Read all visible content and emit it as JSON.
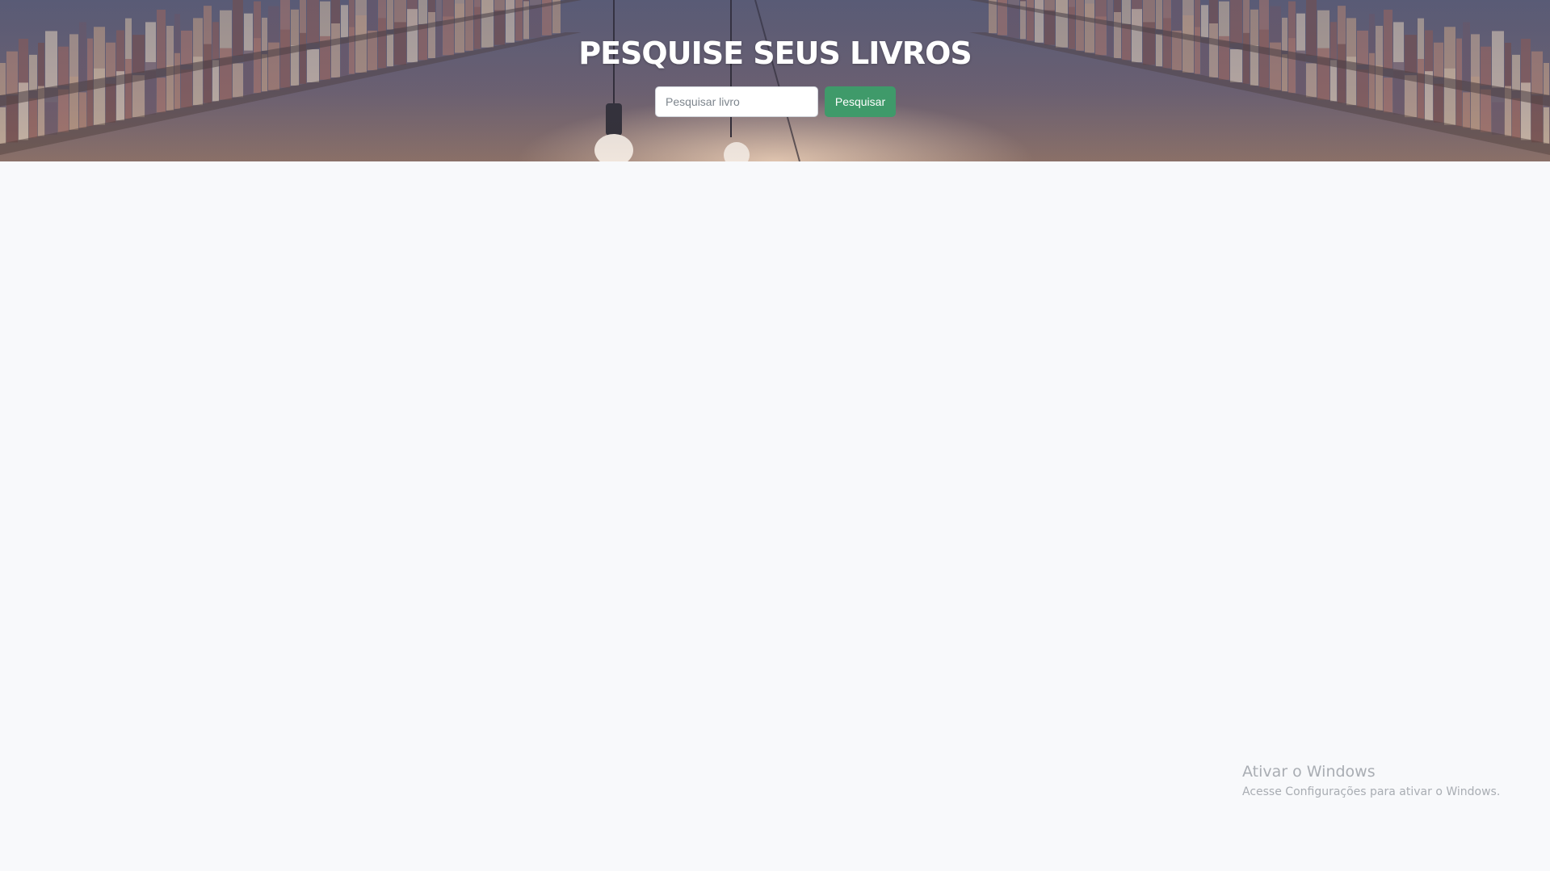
{
  "header": {
    "title": "PESQUISE SEUS LIVROS"
  },
  "search": {
    "placeholder": "Pesquisar livro",
    "value": "",
    "button_label": "Pesquisar"
  },
  "windows_watermark": {
    "title": "Ativar o Windows",
    "subtitle": "Acesse Configurações para ativar o Windows."
  },
  "colors": {
    "accent": "#3f9a6a",
    "page_background": "#f8f9fb"
  },
  "icons": {
    "hero_background": "library-bookshelf-image"
  }
}
